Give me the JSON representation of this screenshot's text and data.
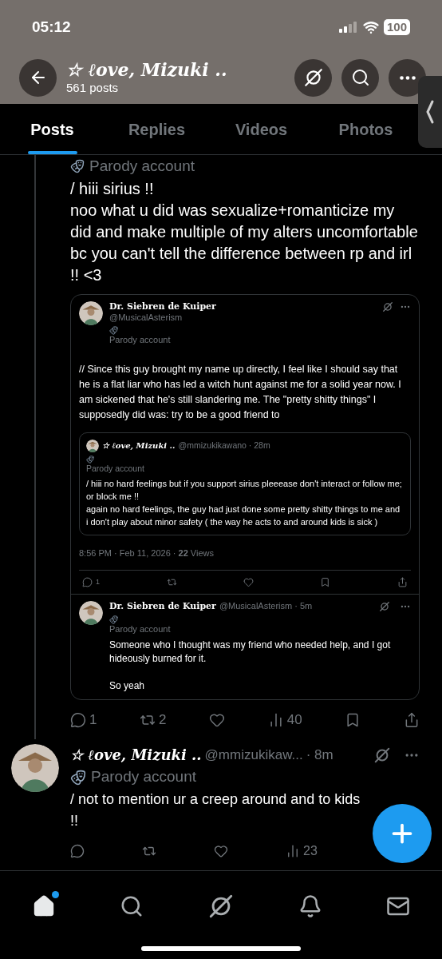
{
  "status_bar": {
    "time": "05:12",
    "battery": "100"
  },
  "header": {
    "title": "☆ ℓove, Mizuki ..",
    "subtitle": "561 posts"
  },
  "tabs": [
    {
      "label": "Posts",
      "selected": true
    },
    {
      "label": "Replies",
      "selected": false
    },
    {
      "label": "Videos",
      "selected": false
    },
    {
      "label": "Photos",
      "selected": false
    }
  ],
  "thread_post": {
    "badge": "Parody account",
    "text": "/  hiii  sirius !!\nnoo what u did was sexualize+romanticize my did and make multiple of my alters uncomfortable bc you can't tell the difference between rp and irl !!  <3",
    "quote": {
      "name": "Dr. Siebren de Kuiper",
      "handle": "@MusicalAsterism",
      "badge": "Parody account",
      "text": "// Since this guy brought my name up directly, I feel like I should say that he is a flat liar who has led a witch hunt against me for a solid year now. I am sickened that he's still slandering me. The \"pretty shitty things\" I supposedly did was: try to be a good friend to",
      "inner": {
        "name": "☆ ℓove, Mizuki ..",
        "handle": "@mmizukikawano · 28m",
        "badge": "Parody account",
        "text": "/  hiii no hard feelings but if you support sirius pleeease don't interact or follow me; or block me !!\nagain no hard feelings, the guy had just done some pretty shitty things to me and i don't play about minor safety  ( the way he acts to and around kids is sick )"
      },
      "meta": "8:56 PM · Feb 11, 2026 · **22** Views",
      "replies": "1",
      "reply": {
        "name": "Dr. Siebren de Kuiper",
        "handle": "@MusicalAsterism · 5m",
        "badge": "Parody account",
        "text": "Someone who I thought was my friend who needed help, and I got hideously burned for it.\n\nSo yeah"
      }
    },
    "actions": {
      "replies": "1",
      "reposts": "2",
      "views": "40"
    }
  },
  "post": {
    "name": "☆ ℓove, Mizuki ..",
    "handle": "@mmizukikaw...",
    "time": "· 8m",
    "badge": "Parody account",
    "text": "/  not to mention ur a creep around and to kids !!",
    "views": "23"
  },
  "nav": [
    {
      "kind": "home",
      "selected": true,
      "unread": true
    },
    {
      "kind": "search",
      "selected": false
    },
    {
      "kind": "grok",
      "selected": false
    },
    {
      "kind": "bell",
      "selected": false
    },
    {
      "kind": "mail",
      "selected": false
    }
  ]
}
